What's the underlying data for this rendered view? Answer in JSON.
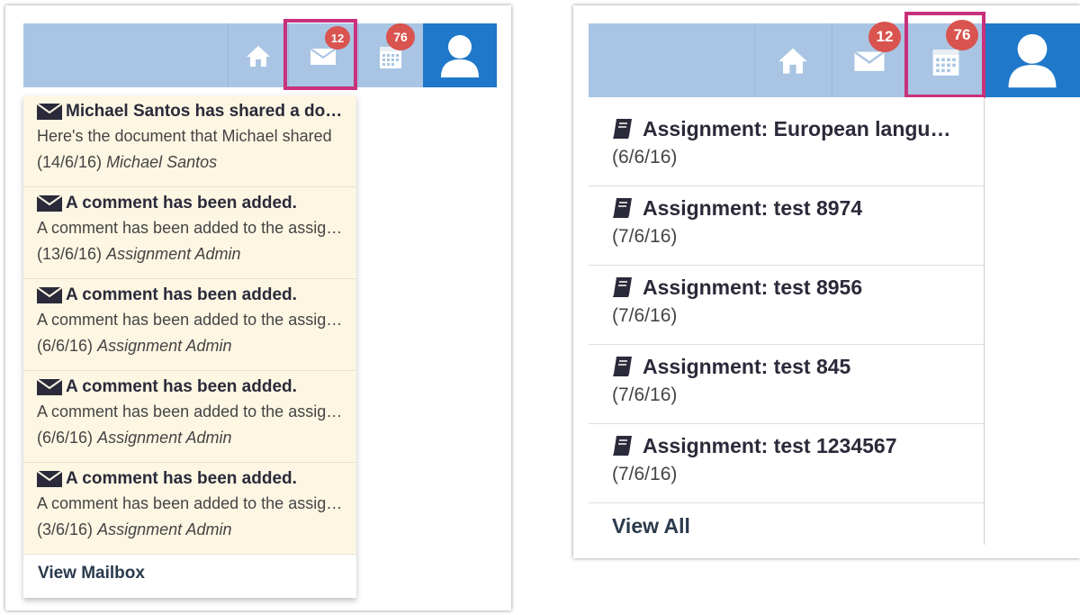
{
  "colors": {
    "nav_background": "#a9c5e3",
    "user_button": "#1f78c9",
    "badge": "#d9534f",
    "highlight_border": "#c8317b",
    "mail_item_background": "#fdf6e3"
  },
  "left_panel": {
    "nav": {
      "icons": [
        "home-icon",
        "envelope-icon",
        "calendar-icon",
        "user-icon"
      ],
      "mail_badge": "12",
      "calendar_badge": "76",
      "highlighted": "mail"
    },
    "messages": [
      {
        "icon": "envelope-icon",
        "subject": "Michael Santos has shared a document",
        "preview": "Here's the document that Michael shared",
        "date": "(14/6/16)",
        "author": "Michael Santos"
      },
      {
        "icon": "envelope-icon",
        "subject": "A comment has been added.",
        "preview": "A comment has been added to the assignment",
        "date": "(13/6/16)",
        "author": "Assignment Admin"
      },
      {
        "icon": "envelope-icon",
        "subject": "A comment has been added.",
        "preview": "A comment has been added to the assignment",
        "date": "(6/6/16)",
        "author": "Assignment Admin"
      },
      {
        "icon": "envelope-icon",
        "subject": "A comment has been added.",
        "preview": "A comment has been added to the assignment",
        "date": "(6/6/16)",
        "author": "Assignment Admin"
      },
      {
        "icon": "envelope-icon",
        "subject": "A comment has been added.",
        "preview": "A comment has been added to the assignment",
        "date": "(3/6/16)",
        "author": "Assignment Admin"
      }
    ],
    "view_mailbox_label": "View Mailbox"
  },
  "right_panel": {
    "nav": {
      "icons": [
        "home-icon",
        "envelope-icon",
        "calendar-icon",
        "user-icon"
      ],
      "mail_badge": "12",
      "calendar_badge": "76",
      "highlighted": "calendar"
    },
    "assignments": [
      {
        "icon": "book-icon",
        "title": "Assignment: European languages",
        "date": "(6/6/16)"
      },
      {
        "icon": "book-icon",
        "title": "Assignment: test 8974",
        "date": "(7/6/16)"
      },
      {
        "icon": "book-icon",
        "title": "Assignment: test 8956",
        "date": "(7/6/16)"
      },
      {
        "icon": "book-icon",
        "title": "Assignment: test 845",
        "date": "(7/6/16)"
      },
      {
        "icon": "book-icon",
        "title": "Assignment: test 1234567",
        "date": "(7/6/16)"
      }
    ],
    "view_all_label": "View All"
  }
}
